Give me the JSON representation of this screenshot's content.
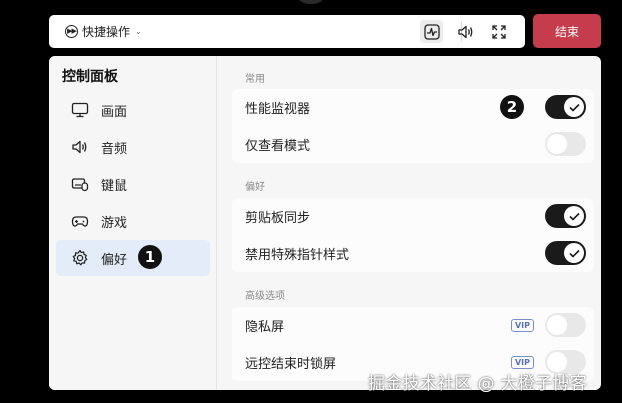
{
  "toolbar": {
    "quick_ops_label": "快捷操作",
    "quick_ops_icon": "fast-forward-circle-icon",
    "chevron_icon": "chevron-down-icon",
    "icons": [
      "performance-monitor-icon",
      "volume-icon",
      "fullscreen-icon"
    ]
  },
  "end_button": {
    "label": "结束",
    "color": "#c53d4c"
  },
  "sidebar": {
    "title": "控制面板",
    "items": [
      {
        "label": "画面",
        "icon": "monitor-icon",
        "active": false
      },
      {
        "label": "音频",
        "icon": "speaker-icon",
        "active": false
      },
      {
        "label": "键鼠",
        "icon": "keyboard-mouse-icon",
        "active": false
      },
      {
        "label": "游戏",
        "icon": "gamepad-icon",
        "active": false
      },
      {
        "label": "偏好",
        "icon": "gear-icon",
        "active": true
      }
    ]
  },
  "sections": [
    {
      "title": "常用",
      "rows": [
        {
          "label": "性能监视器",
          "enabled": true
        },
        {
          "label": "仅查看模式",
          "enabled": false
        }
      ]
    },
    {
      "title": "偏好",
      "rows": [
        {
          "label": "剪贴板同步",
          "enabled": true
        },
        {
          "label": "禁用特殊指针样式",
          "enabled": true
        }
      ]
    },
    {
      "title": "高级选项",
      "rows": [
        {
          "label": "隐私屏",
          "enabled": false,
          "badge": "VIP"
        },
        {
          "label": "远控结束时锁屏",
          "enabled": false,
          "badge": "VIP"
        }
      ]
    }
  ],
  "annotations": {
    "step1": "1",
    "step2": "2"
  },
  "watermark": "掘金技术社区 @ 大橙子博客",
  "colors": {
    "accent_dark": "#1a1a1a",
    "active_bg": "#e3ecf8",
    "vip": "#5b70b8"
  }
}
